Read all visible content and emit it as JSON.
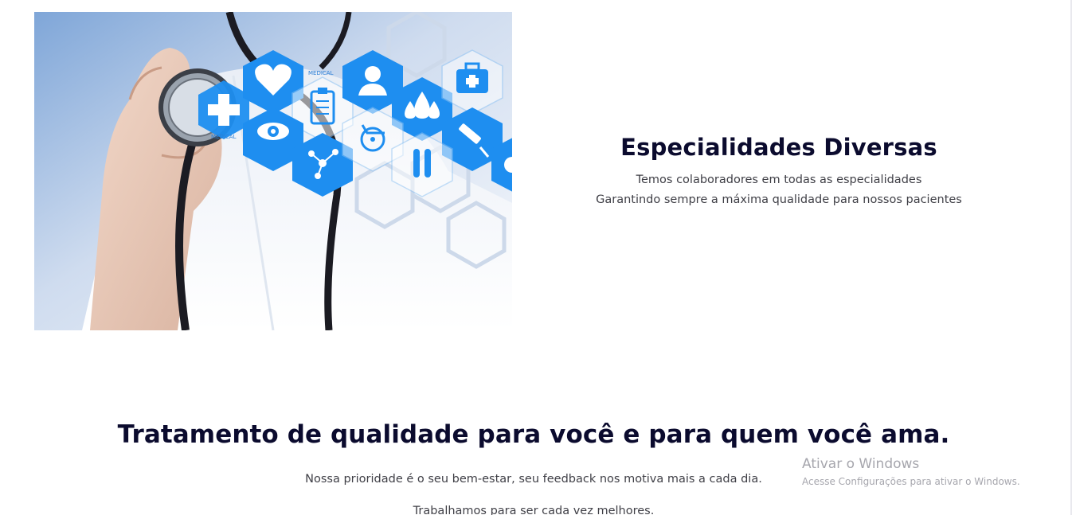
{
  "image": {
    "icons": [
      "plus-icon",
      "heart-icon",
      "clipboard-icon",
      "doctor-icon",
      "drops-icon",
      "medkit-icon",
      "eye-icon",
      "molecule-icon",
      "wheelchair-icon",
      "syringe-icon",
      "test-tubes-icon",
      "stethoscope-icon"
    ],
    "hex_color": "#1e8ef0",
    "labels": [
      "MEDICAL",
      "MEDICAL"
    ]
  },
  "feature": {
    "title": "Especialidades Diversas",
    "line1": "Temos colaboradores em todas as especialidades",
    "line2": "Garantindo sempre a máxima qualidade para nossos pacientes"
  },
  "section": {
    "title": "Tratamento de qualidade para você e para quem você ama.",
    "paragraph1": "Nossa prioridade é o seu bem-estar, seu feedback nos motiva mais a cada dia.",
    "paragraph2": "Trabalhamos para ser cada vez melhores."
  },
  "watermark": {
    "title": "Ativar o Windows",
    "subtitle": "Acesse Configurações para ativar o Windows."
  },
  "colors": {
    "heading": "#0b0b2e",
    "body_text": "#3f3f46",
    "watermark": "#a6a6ad",
    "accent_blue": "#1e8ef0"
  }
}
